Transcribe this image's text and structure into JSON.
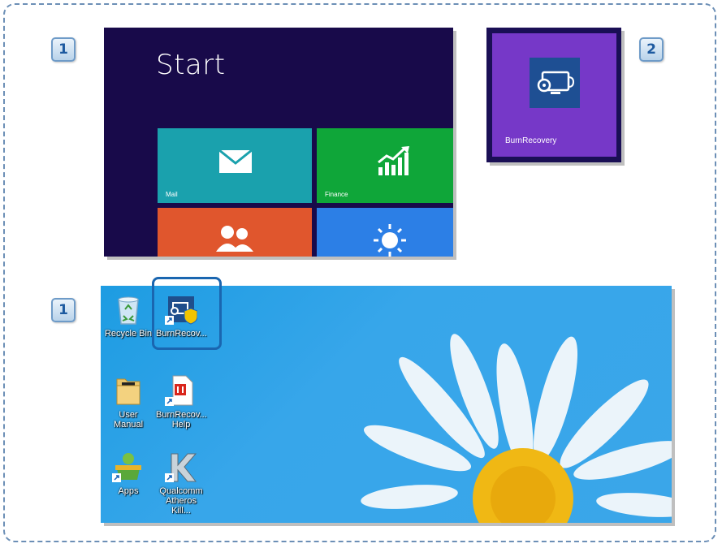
{
  "steps": {
    "one_a": "1",
    "two": "2",
    "one_b": "1"
  },
  "start_screen": {
    "title": "Start",
    "tiles": [
      {
        "label": "Mail",
        "color": "#1aa1ad",
        "icon": "mail-icon"
      },
      {
        "label": "Finance",
        "color": "#0fa639",
        "icon": "finance-chart-icon"
      },
      {
        "label": "",
        "color": "#e0562d",
        "icon": "people-icon"
      },
      {
        "label": "",
        "color": "#2c7fe6",
        "icon": "weather-sun-icon"
      }
    ]
  },
  "pinned_tile": {
    "label": "BurnRecovery",
    "color": "#7638c8",
    "icon": "burnrecovery-icon"
  },
  "desktop": {
    "icons": [
      {
        "label": "Recycle Bin",
        "icon": "recycle-bin-icon"
      },
      {
        "label": "BurnRecov...",
        "icon": "burnrecovery-shortcut-icon"
      },
      {
        "label": "User Manual",
        "icon": "folder-icon"
      },
      {
        "label": "BurnRecov... Help",
        "icon": "pdf-help-icon"
      },
      {
        "label": "Apps",
        "icon": "apps-store-icon"
      },
      {
        "label": "Qualcomm Atheros Kill...",
        "icon": "qualcomm-killer-icon"
      }
    ]
  }
}
